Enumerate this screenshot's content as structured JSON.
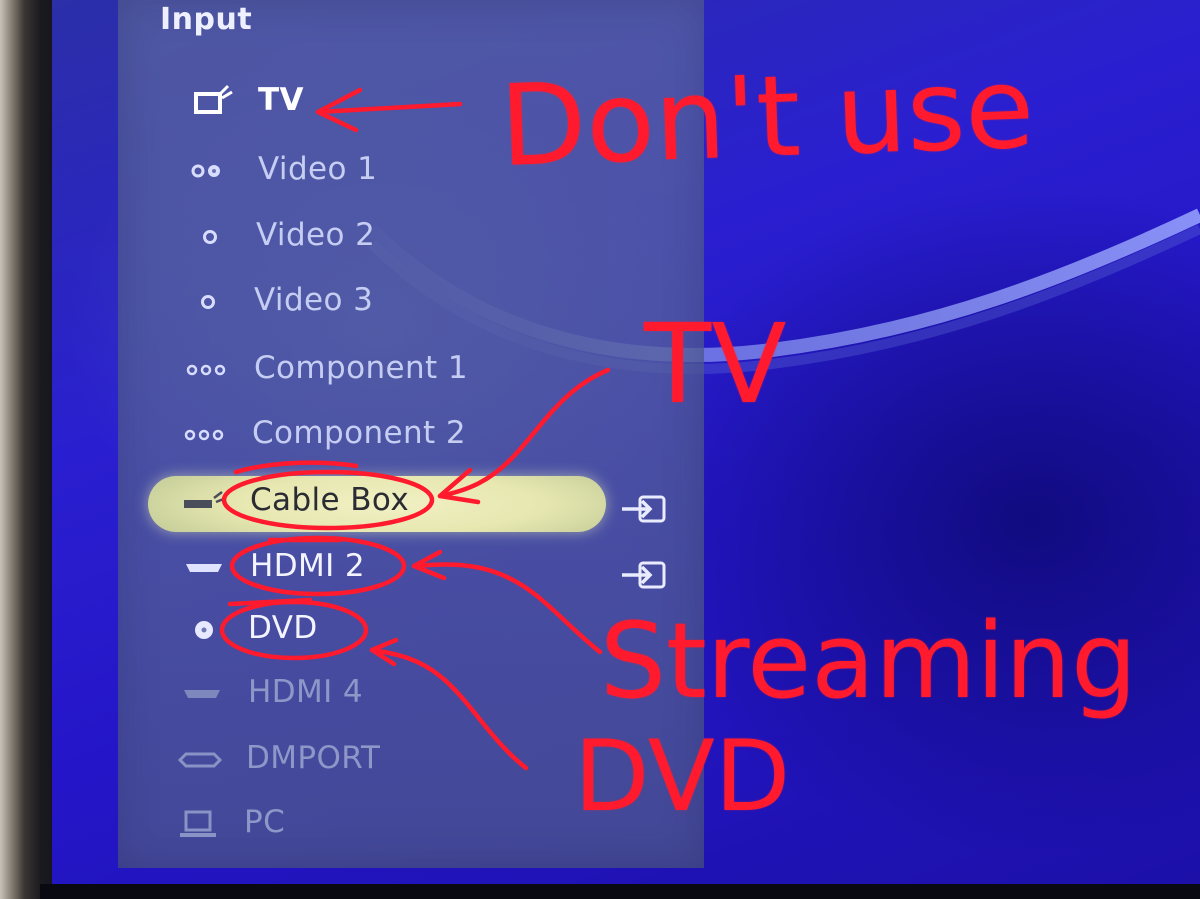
{
  "menu": {
    "title": "Input",
    "items": [
      {
        "label": "TV",
        "icon": "tv-antenna-icon"
      },
      {
        "label": "Video 1",
        "icon": "composite-jack-icon"
      },
      {
        "label": "Video 2",
        "icon": "circle-jack-icon"
      },
      {
        "label": "Video 3",
        "icon": "circle-jack-icon"
      },
      {
        "label": "Component 1",
        "icon": "component-jacks-icon"
      },
      {
        "label": "Component 2",
        "icon": "component-jacks-icon"
      },
      {
        "label": "Cable Box",
        "icon": "cable-box-icon"
      },
      {
        "label": "HDMI 2",
        "icon": "hdmi-port-icon"
      },
      {
        "label": "DVD",
        "icon": "disc-icon"
      },
      {
        "label": "HDMI 4",
        "icon": "hdmi-port-icon"
      },
      {
        "label": "DMPORT",
        "icon": "dmport-icon"
      },
      {
        "label": "PC",
        "icon": "computer-icon"
      }
    ],
    "selected": "Cable Box"
  },
  "annotations": {
    "tv_note": "Don't use",
    "cable_note": "TV",
    "hdmi_note": "Streaming",
    "dvd_note": "DVD"
  },
  "colors": {
    "annotation": "#ff1a2e",
    "highlight": "#e6e7b0",
    "screen_blue": "#2a1fd0"
  }
}
